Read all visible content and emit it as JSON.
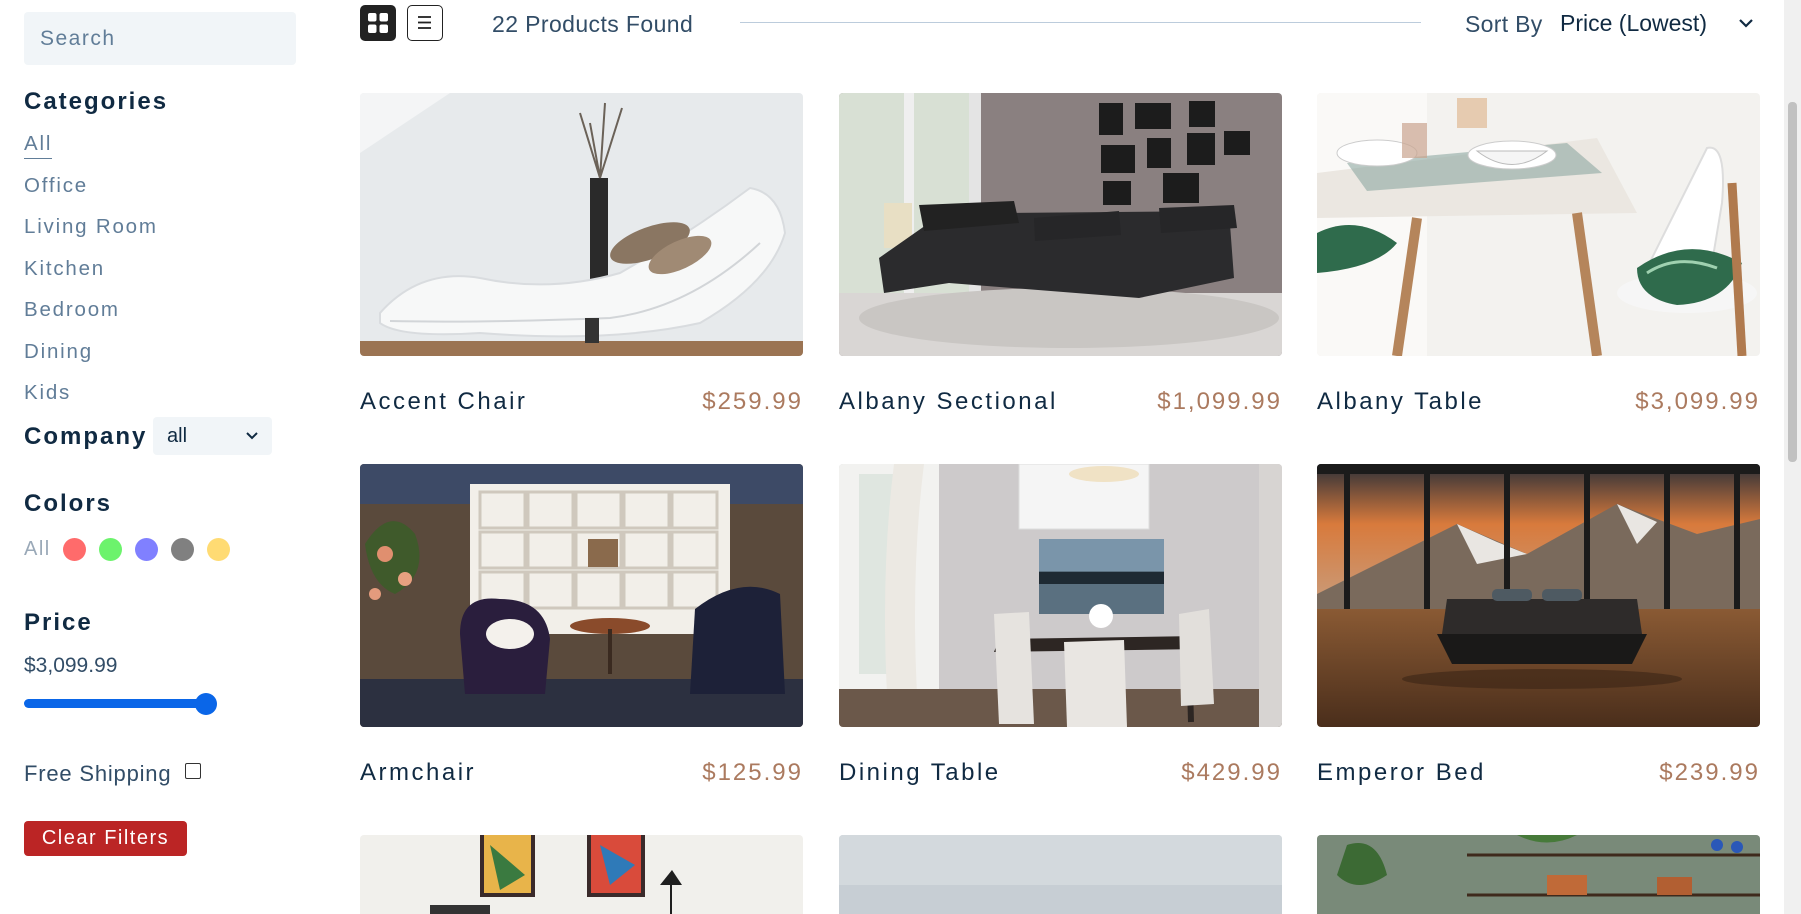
{
  "search": {
    "placeholder": "Search"
  },
  "filters": {
    "categories_title": "Categories",
    "categories": [
      "All",
      "Office",
      "Living Room",
      "Kitchen",
      "Bedroom",
      "Dining",
      "Kids"
    ],
    "active_category": "All",
    "company_title": "Company",
    "company_value": "all",
    "colors_title": "Colors",
    "colors_all": "All",
    "colors": [
      "#ff6b6b",
      "#6cf36c",
      "#8080ff",
      "#808080",
      "#ffdb73"
    ],
    "price_title": "Price",
    "price_value": "$3,099.99",
    "price_slider_fraction": 1.0,
    "shipping_label": "Free Shipping",
    "shipping_checked": false,
    "clear_label": "Clear Filters"
  },
  "toolbar": {
    "found_text": "22 Products Found",
    "sort_label": "Sort By",
    "sort_value": "Price (Lowest)"
  },
  "products": [
    {
      "name": "Accent Chair",
      "price": "$259.99"
    },
    {
      "name": "Albany Sectional",
      "price": "$1,099.99"
    },
    {
      "name": "Albany Table",
      "price": "$3,099.99"
    },
    {
      "name": "Armchair",
      "price": "$125.99"
    },
    {
      "name": "Dining Table",
      "price": "$429.99"
    },
    {
      "name": "Emperor Bed",
      "price": "$239.99"
    }
  ],
  "colors": {
    "accent": "#ab7a5f",
    "danger": "#bb2525",
    "primary": "#102a42",
    "slider": "#0a66e8"
  }
}
